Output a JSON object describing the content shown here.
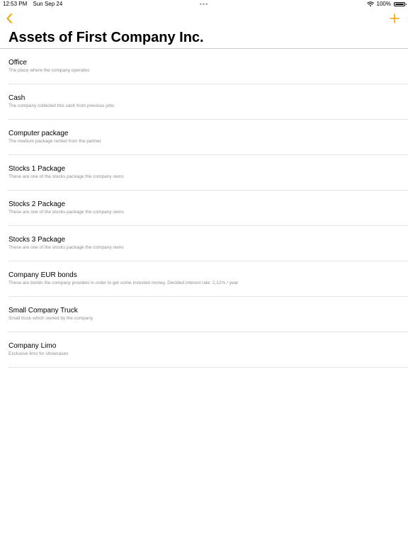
{
  "status_bar": {
    "time": "12:53 PM",
    "date": "Sun Sep 24",
    "center_dots": "•••",
    "battery": "100%"
  },
  "nav": {
    "back_icon": "chevron-left-icon",
    "add_icon": "plus-icon",
    "accent_color": "#f4a300"
  },
  "page": {
    "title": "Assets of First Company Inc."
  },
  "assets": [
    {
      "title": "Office",
      "subtitle": "The place where the company operates"
    },
    {
      "title": "Cash",
      "subtitle": "The company collected this cash from previous jobs"
    },
    {
      "title": "Computer package",
      "subtitle": "The medium package rented from the partner"
    },
    {
      "title": "Stocks 1 Package",
      "subtitle": "These are one of the stocks package the company owns"
    },
    {
      "title": "Stocks 2 Package",
      "subtitle": "These are one of the stocks package the company owns"
    },
    {
      "title": "Stocks 3 Package",
      "subtitle": "These are one of the stocks package the company owns"
    },
    {
      "title": "Company EUR bonds",
      "subtitle": "These are bonds the company provides in order to get some invested money. Decided interest rate: 2,12% / year"
    },
    {
      "title": "Small Company Truck",
      "subtitle": "Small truck which owned by the company"
    },
    {
      "title": "Company Limo",
      "subtitle": "Exclusive limo for showcases"
    }
  ]
}
